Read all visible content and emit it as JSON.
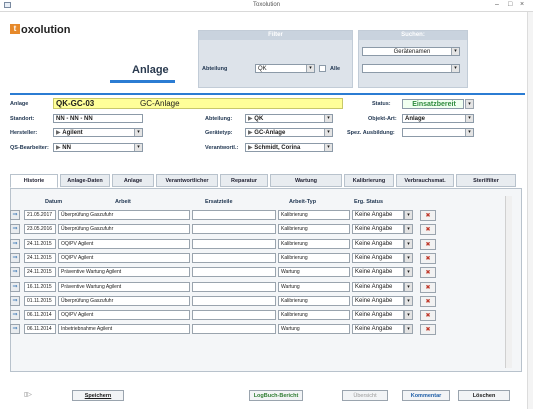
{
  "window": {
    "title": "Toxolution",
    "min": "–",
    "max": "□",
    "close": "×"
  },
  "logo": {
    "mark": "t",
    "text": "oxolution"
  },
  "page_title": "Anlage",
  "filter": {
    "heading": "Filter",
    "abteilung_label": "Abteilung",
    "abteilung_value": "QK",
    "alle_label": "Alle"
  },
  "search": {
    "heading": "Suchen:",
    "mode_value": "Gerätenamen",
    "query_value": ""
  },
  "anlage": {
    "label": "Anlage",
    "code": "QK-GC-03",
    "name": "GC-Anlage",
    "status_label": "Status:",
    "status_value": "Einsatzbereit",
    "standort_label": "Standort:",
    "standort_value": "NN - NN - NN",
    "abteilung_label": "Abteilung:",
    "abteilung_value": "QK",
    "objektart_label": "Objekt-Art:",
    "objektart_value": "Anlage",
    "hersteller_label": "Hersteller:",
    "hersteller_value": "Agilent",
    "geraetetyp_label": "Gerätetyp:",
    "geraetetyp_value": "GC-Anlage",
    "spez_label": "Spez. Ausbildung:",
    "spez_value": "",
    "qs_label": "QS-Bearbeiter:",
    "qs_value": "NN",
    "verantw_label": "Verantwortl.:",
    "verantw_value": "Schmidt, Corina"
  },
  "tabs": [
    "Historie",
    "Anlage-Daten",
    "Anlage",
    "Verantwortlicher",
    "Reparatur",
    "Wartung",
    "Kalibrierung",
    "Verbrauchsmat.",
    "Sterilfilter"
  ],
  "grid": {
    "headers": [
      "Datum",
      "Arbeit",
      "Ersatzteile",
      "Arbeit-Typ",
      "Erg. Status"
    ],
    "rows": [
      {
        "date": "21.05.2017",
        "work": "Überprüfung Gaszufuhr",
        "parts": "",
        "type": "Kalibrierung",
        "status": "Keine Angabe"
      },
      {
        "date": "23.05.2016",
        "work": "Überprüfung Gaszufuhr",
        "parts": "",
        "type": "Kalibrierung",
        "status": "Keine Angabe"
      },
      {
        "date": "24.11.2015",
        "work": "OQ/PV Agilent",
        "parts": "",
        "type": "Kalibrierung",
        "status": "Keine Angabe"
      },
      {
        "date": "24.11.2015",
        "work": "OQ/PV Agilent",
        "parts": "",
        "type": "Kalibrierung",
        "status": "Keine Angabe"
      },
      {
        "date": "24.11.2015",
        "work": "Präventive Wartung Agilent",
        "parts": "",
        "type": "Wartung",
        "status": "Keine Angabe"
      },
      {
        "date": "16.11.2015",
        "work": "Präventive Wartung Agilent",
        "parts": "",
        "type": "Wartung",
        "status": "Keine Angabe"
      },
      {
        "date": "01.11.2015",
        "work": "Überprüfung Gaszufuhr",
        "parts": "",
        "type": "Kalibrierung",
        "status": "Keine Angabe"
      },
      {
        "date": "06.11.2014",
        "work": "OQ/PV Agilent",
        "parts": "",
        "type": "Kalibrierung",
        "status": "Keine Angabe"
      },
      {
        "date": "06.11.2014",
        "work": "Inbetriebnahme Agilent",
        "parts": "",
        "type": "Wartung",
        "status": "Keine Angabe"
      }
    ]
  },
  "footer": {
    "speichern": "Speichern",
    "logbuch": "LogBuch-Bericht",
    "uebersicht": "Übersicht",
    "kommentar": "Kommentar",
    "loeschen": "Löschen"
  },
  "colors": {
    "accent": "#2b7cd3",
    "highlight": "#ffff99",
    "status_green": "#2e8b3d",
    "logo_orange": "#e6892b"
  }
}
